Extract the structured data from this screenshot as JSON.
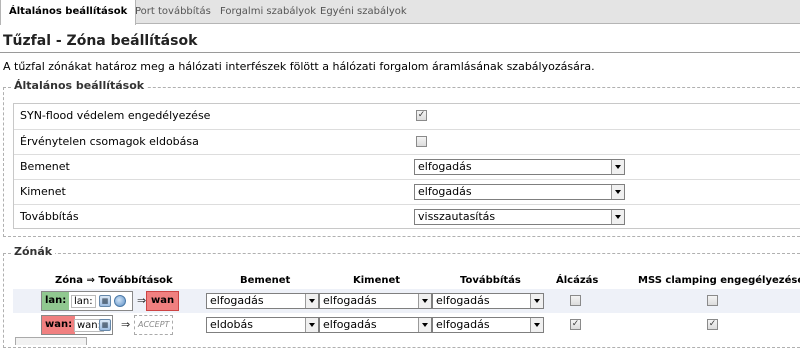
{
  "tabs": [
    {
      "label": "Általános beállítások",
      "active": true
    },
    {
      "label": "Port továbbítás",
      "active": false
    },
    {
      "label": "Forgalmi szabályok",
      "active": false
    },
    {
      "label": "Egyéni szabályok",
      "active": false
    }
  ],
  "page_title": "Tűzfal - Zóna beállítások",
  "description": "A tűzfal zónákat határoz meg a hálózati interfészek fölött a hálózati forgalom áramlásának szabályozására.",
  "general": {
    "legend": "Általános beállítások",
    "rows": [
      {
        "label": "SYN-flood védelem engedélyezése",
        "checked": true
      },
      {
        "label": "Érvénytelen csomagok eldobása",
        "checked": false
      },
      {
        "label": "Bemenet",
        "value": "elfogadás"
      },
      {
        "label": "Kimenet",
        "value": "elfogadás"
      },
      {
        "label": "Továbbítás",
        "value": "visszautasítás"
      }
    ]
  },
  "zones": {
    "legend": "Zónák",
    "headers": {
      "zone": "Zóna ⇒ Továbbítások",
      "input": "Bemenet",
      "output": "Kimenet",
      "forward": "Továbbítás",
      "masq": "Álcázás",
      "mss": "MSS clamping engegélyezése"
    },
    "forward_symbol": "⇒",
    "rows": [
      {
        "name": "lan:",
        "iface": "lan:",
        "name_color": "#90c890",
        "target": "wan",
        "target_color": "#f08080",
        "input": "elfogadás",
        "output": "elfogadás",
        "forward": "elfogadás",
        "masq": false,
        "mss": false
      },
      {
        "name": "wan:",
        "iface": "wan:",
        "name_color": "#f08080",
        "target": "ACCEPT",
        "input": "eldobás",
        "output": "elfogadás",
        "forward": "elfogadás",
        "masq": true,
        "mss": true
      }
    ]
  },
  "check_mark": "✓"
}
